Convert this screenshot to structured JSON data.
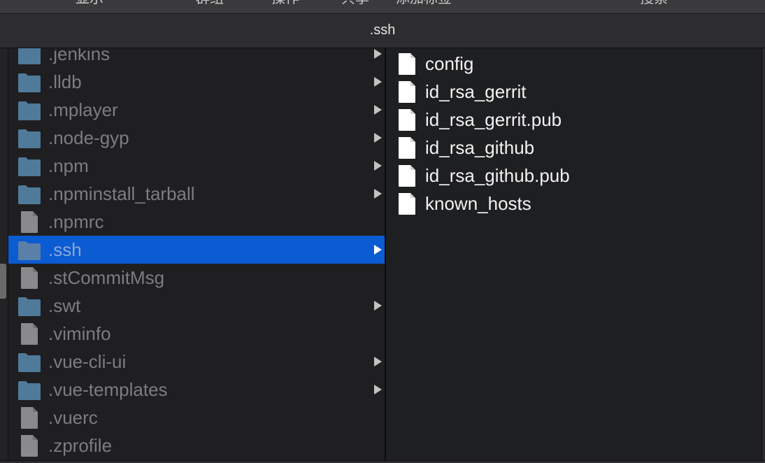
{
  "toolbar": {
    "items": [
      {
        "label": "显示"
      },
      {
        "label": "群组"
      },
      {
        "label": "操作"
      },
      {
        "label": "共享"
      },
      {
        "label": "添加标签"
      },
      {
        "label": "搜索"
      }
    ]
  },
  "tab": {
    "title": ".ssh"
  },
  "column1": {
    "items": [
      {
        "name": ".jenkins",
        "kind": "folder",
        "has_children": true
      },
      {
        "name": ".lldb",
        "kind": "folder",
        "has_children": true
      },
      {
        "name": ".mplayer",
        "kind": "folder",
        "has_children": true
      },
      {
        "name": ".node-gyp",
        "kind": "folder",
        "has_children": true
      },
      {
        "name": ".npm",
        "kind": "folder",
        "has_children": true
      },
      {
        "name": ".npminstall_tarball",
        "kind": "folder",
        "has_children": true
      },
      {
        "name": ".npmrc",
        "kind": "file",
        "has_children": false
      },
      {
        "name": ".ssh",
        "kind": "folder",
        "has_children": true,
        "selected": true
      },
      {
        "name": ".stCommitMsg",
        "kind": "file",
        "has_children": false
      },
      {
        "name": ".swt",
        "kind": "folder",
        "has_children": true
      },
      {
        "name": ".viminfo",
        "kind": "file",
        "has_children": false
      },
      {
        "name": ".vue-cli-ui",
        "kind": "folder",
        "has_children": true
      },
      {
        "name": ".vue-templates",
        "kind": "folder",
        "has_children": true
      },
      {
        "name": ".vuerc",
        "kind": "file",
        "has_children": false
      },
      {
        "name": ".zprofile",
        "kind": "file",
        "has_children": false
      }
    ]
  },
  "column2": {
    "items": [
      {
        "name": "config",
        "kind": "file"
      },
      {
        "name": "id_rsa_gerrit",
        "kind": "file"
      },
      {
        "name": "id_rsa_gerrit.pub",
        "kind": "file"
      },
      {
        "name": "id_rsa_github",
        "kind": "file"
      },
      {
        "name": "id_rsa_github.pub",
        "kind": "file"
      },
      {
        "name": "known_hosts",
        "kind": "file"
      }
    ]
  },
  "colors": {
    "selection": "#0b5bd2",
    "folder": "#4f7a9a",
    "dim_text": "#7d7d7f",
    "bright_text": "#f2f2f2"
  }
}
